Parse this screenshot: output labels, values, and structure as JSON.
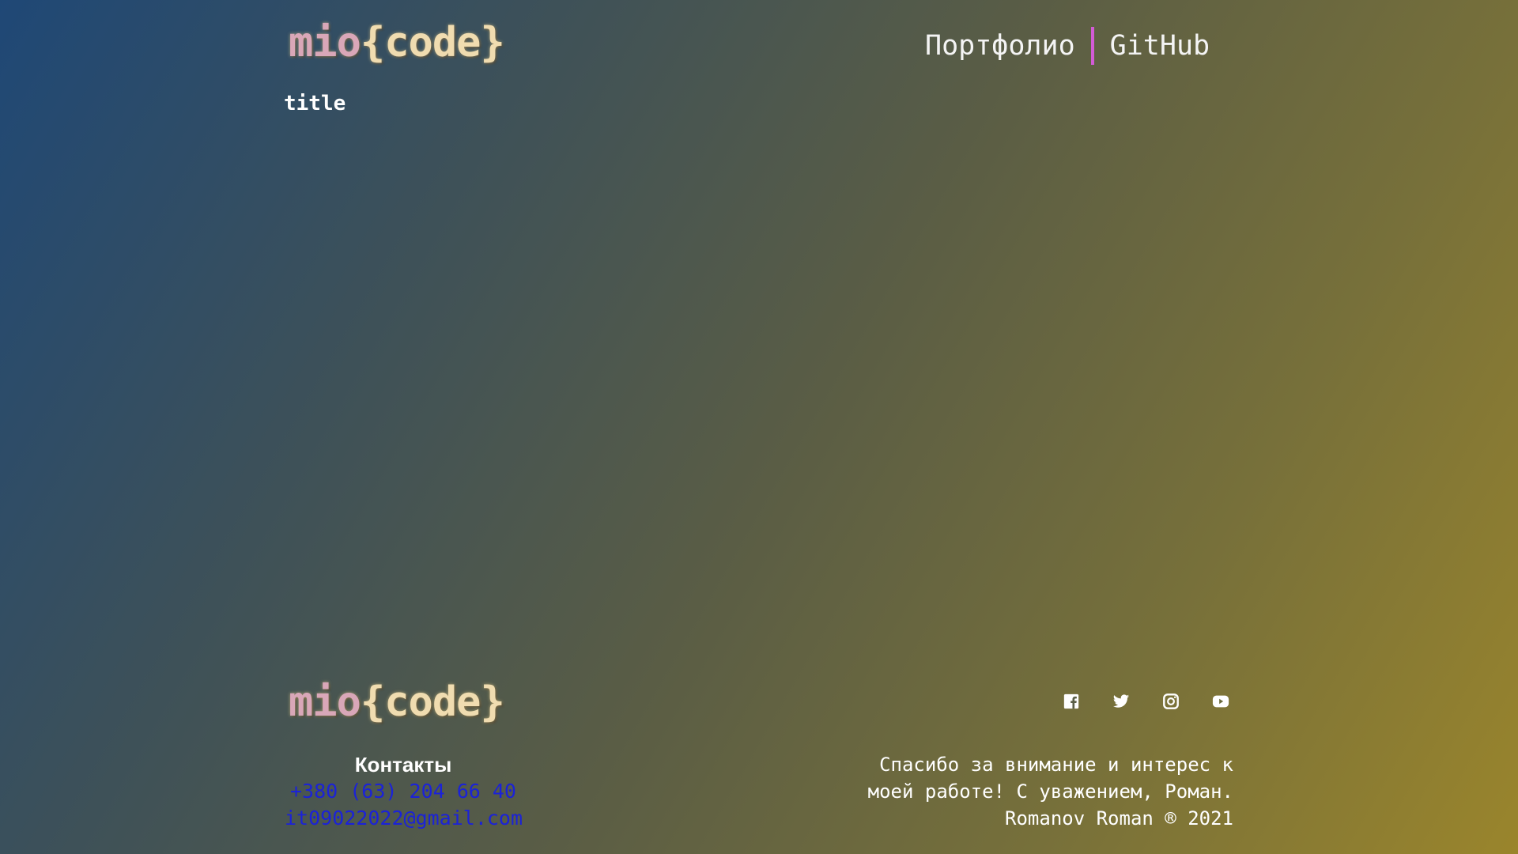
{
  "header": {
    "logo_part1": "mio",
    "logo_part2": "{code}",
    "nav": {
      "portfolio": "Портфолио",
      "github": "GitHub"
    }
  },
  "main": {
    "title": "title"
  },
  "footer": {
    "logo_part1": "mio",
    "logo_part2": "{code}",
    "social_icons": [
      "facebook-icon",
      "twitter-icon",
      "instagram-icon",
      "youtube-icon"
    ],
    "contacts": {
      "title": "Контакты",
      "phone": "+380 (63) 204 66 40",
      "email": "it09022022@gmail.com"
    },
    "thanks": {
      "line1": "Спасибо за внимание и интерес к",
      "line2": "моей работе! С уважением, Роман.",
      "line3": "Romanov Roman ® 2021"
    }
  },
  "colors": {
    "accent_separator": "#d35bd6",
    "link": "#1b22d8",
    "logo_pink": "#d9a7b8",
    "logo_cream": "#f0dcb0"
  }
}
